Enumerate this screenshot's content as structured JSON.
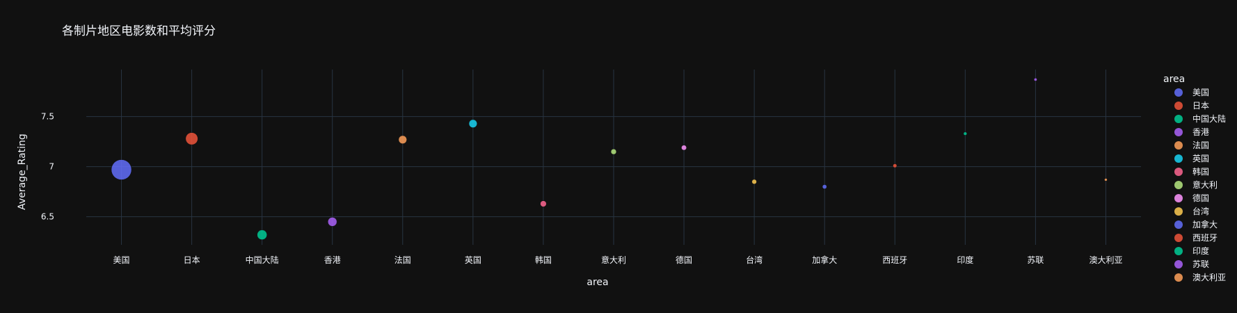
{
  "chart_data": {
    "type": "scatter",
    "title": "各制片地区电影数和平均评分",
    "xlabel": "area",
    "ylabel": "Average_Rating",
    "categories": [
      "美国",
      "日本",
      "中国大陆",
      "香港",
      "法国",
      "英国",
      "韩国",
      "意大利",
      "德国",
      "台湾",
      "加拿大",
      "西班牙",
      "印度",
      "苏联",
      "澳大利亚"
    ],
    "yticks": [
      6.5,
      7,
      7.5
    ],
    "ytick_labels": [
      "6.5",
      "7",
      "7.5"
    ],
    "ylim": [
      6.22,
      7.97
    ],
    "grid": true,
    "legend_title": "area",
    "legend_placement": "right",
    "series": [
      {
        "name": "美国",
        "y": 6.97,
        "count": 55,
        "color": "#636efa"
      },
      {
        "name": "日本",
        "y": 7.28,
        "count": 20,
        "color": "#EF553B"
      },
      {
        "name": "中国大陆",
        "y": 6.32,
        "count": 13,
        "color": "#00cc96"
      },
      {
        "name": "香港",
        "y": 6.45,
        "count": 11,
        "color": "#ab63fa"
      },
      {
        "name": "法国",
        "y": 7.27,
        "count": 9,
        "color": "#FFA15A"
      },
      {
        "name": "英国",
        "y": 7.43,
        "count": 9,
        "color": "#19d3f3"
      },
      {
        "name": "韩国",
        "y": 6.63,
        "count": 5,
        "color": "#FF6692"
      },
      {
        "name": "意大利",
        "y": 7.15,
        "count": 4,
        "color": "#B6E880"
      },
      {
        "name": "德国",
        "y": 7.19,
        "count": 3.5,
        "color": "#FF97FF"
      },
      {
        "name": "台湾",
        "y": 6.85,
        "count": 3,
        "color": "#FECB52"
      },
      {
        "name": "加拿大",
        "y": 6.8,
        "count": 2.5,
        "color": "#636efa"
      },
      {
        "name": "西班牙",
        "y": 7.01,
        "count": 2,
        "color": "#EF553B"
      },
      {
        "name": "印度",
        "y": 7.33,
        "count": 1.5,
        "color": "#00cc96"
      },
      {
        "name": "苏联",
        "y": 7.87,
        "count": 1.2,
        "color": "#ab63fa"
      },
      {
        "name": "澳大利亚",
        "y": 6.87,
        "count": 1,
        "color": "#FFA15A"
      }
    ]
  },
  "colors": {
    "background": "#111111",
    "grid": "#283442",
    "text": "#f2f5fa"
  }
}
